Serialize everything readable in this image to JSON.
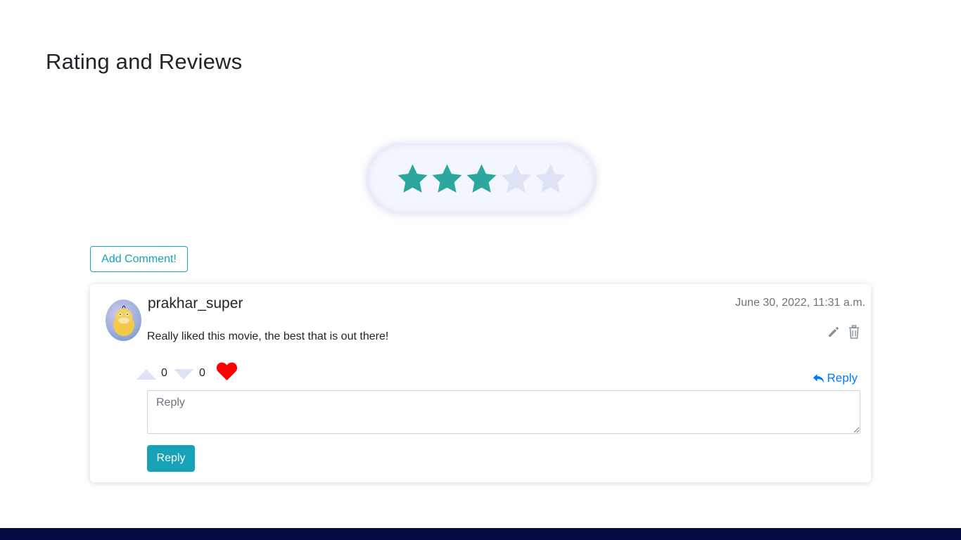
{
  "section": {
    "title": "Rating and Reviews"
  },
  "rating": {
    "value": 3,
    "max": 5,
    "filled_color": "#2ba89b",
    "empty_color": "#dde3f5"
  },
  "actions": {
    "add_comment_label": "Add Comment!"
  },
  "comment": {
    "username": "prakhar_super",
    "timestamp": "June 30, 2022, 11:31 a.m.",
    "text": "Really liked this movie, the best that is out there!",
    "upvotes": "0",
    "downvotes": "0",
    "reply_link_label": "Reply",
    "reply_placeholder": "Reply",
    "reply_button_label": "Reply",
    "avatar_icon": "psyduck-avatar"
  },
  "icons": {
    "edit": "pencil-icon",
    "delete": "trash-icon",
    "upvote": "triangle-up-icon",
    "downvote": "triangle-down-icon",
    "like": "heart-icon",
    "reply": "reply-arrow-icon"
  },
  "colors": {
    "accent": "#17a2b8",
    "link": "#007bff",
    "heart": "#ff0000",
    "footer": "#070a45"
  }
}
